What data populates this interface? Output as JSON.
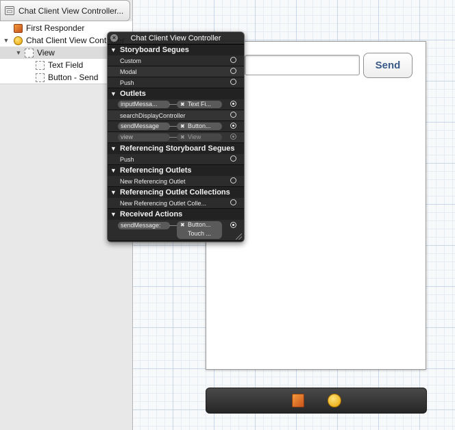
{
  "outline": {
    "header_title": "Chat Client View Controller...",
    "items": [
      {
        "label": "First Responder",
        "icon": "first-responder-cube-icon"
      },
      {
        "label": "Chat Client View Controller",
        "icon": "view-controller-icon"
      },
      {
        "label": "View",
        "icon": "view-icon"
      },
      {
        "label": "Text Field",
        "icon": "text-field-icon"
      },
      {
        "label": "Button - Send",
        "icon": "button-icon"
      }
    ]
  },
  "scene": {
    "send_button_label": "Send"
  },
  "hud": {
    "title": "Chat Client View Controller",
    "sections": {
      "storyboard_segues": "Storyboard Segues",
      "outlets": "Outlets",
      "ref_storyboard_segues": "Referencing Storyboard Segues",
      "ref_outlets": "Referencing Outlets",
      "ref_outlet_collections": "Referencing Outlet Collections",
      "received_actions": "Received Actions"
    },
    "segues": [
      "Custom",
      "Modal",
      "Push"
    ],
    "outlets": [
      {
        "name": "inputMessa...",
        "target": "Text Fi..."
      },
      {
        "name": "searchDisplayController"
      },
      {
        "name": "sendMessage",
        "target": "Button..."
      },
      {
        "name": "view",
        "target": "View"
      }
    ],
    "ref_segues": [
      "Push"
    ],
    "ref_outlets": [
      "New Referencing Outlet"
    ],
    "ref_collections": [
      "New Referencing Outlet Colle..."
    ],
    "actions": [
      {
        "name": "sendMessage:",
        "target": "Button...",
        "event": "Touch ..."
      }
    ]
  },
  "colors": {
    "send_text": "#3a5a89",
    "hud_bg": "#1c1c1c"
  }
}
